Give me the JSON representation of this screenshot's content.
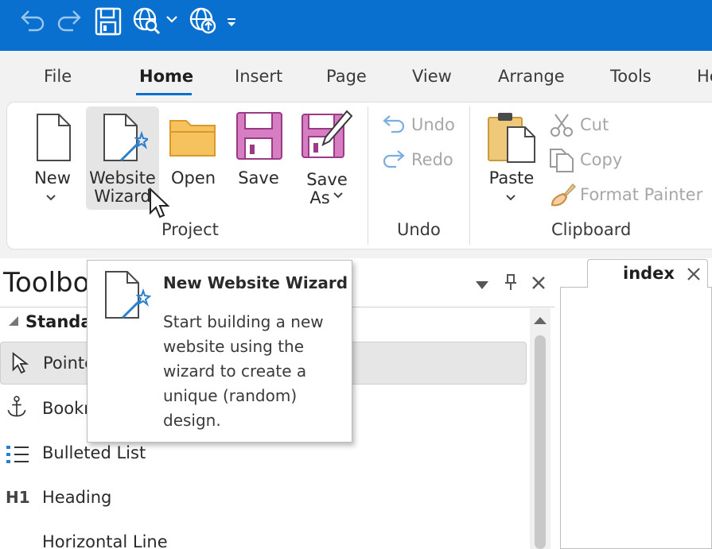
{
  "quick_access": {
    "icons": [
      "undo-icon",
      "redo-icon",
      "save-icon",
      "preview-web-icon",
      "dropdown-icon",
      "publish-web-icon",
      "customize-icon"
    ]
  },
  "ribbon_tabs": [
    "File",
    "Home",
    "Insert",
    "Page",
    "View",
    "Arrange",
    "Tools",
    "He"
  ],
  "active_tab": "Home",
  "ribbon": {
    "project": {
      "group_label": "Project",
      "new": "New",
      "website_wizard_line1": "Website",
      "website_wizard_line2": "Wizard",
      "open": "Open",
      "save": "Save",
      "save_as_line1": "Save",
      "save_as_line2": "As"
    },
    "undo": {
      "group_label": "Undo",
      "undo": "Undo",
      "redo": "Redo"
    },
    "clipboard": {
      "group_label": "Clipboard",
      "paste": "Paste",
      "cut": "Cut",
      "copy": "Copy",
      "format_painter": "Format Painter"
    }
  },
  "toolbox": {
    "title": "Toolbo",
    "section": "Standar",
    "items": [
      {
        "label": "Pointe",
        "icon": "pointer-icon"
      },
      {
        "label": "Bookm",
        "icon": "anchor-icon"
      },
      {
        "label": "Bulleted List",
        "icon": "bulleted-list-icon"
      },
      {
        "label": "Heading",
        "icon": "heading-icon"
      },
      {
        "label": "Horizontal Line",
        "icon": "horizontal-line-icon"
      }
    ],
    "heading_icon_text": "H1"
  },
  "document": {
    "tab_label": "index"
  },
  "tooltip": {
    "title": "New Website Wizard",
    "body": "Start building a new website using the wizard to create a unique (random) design."
  },
  "colors": {
    "accent": "#0a70d0",
    "folder": "#f5c25e",
    "save_purple": "#cf6fb8",
    "disabled_blue": "#7aaee0"
  }
}
